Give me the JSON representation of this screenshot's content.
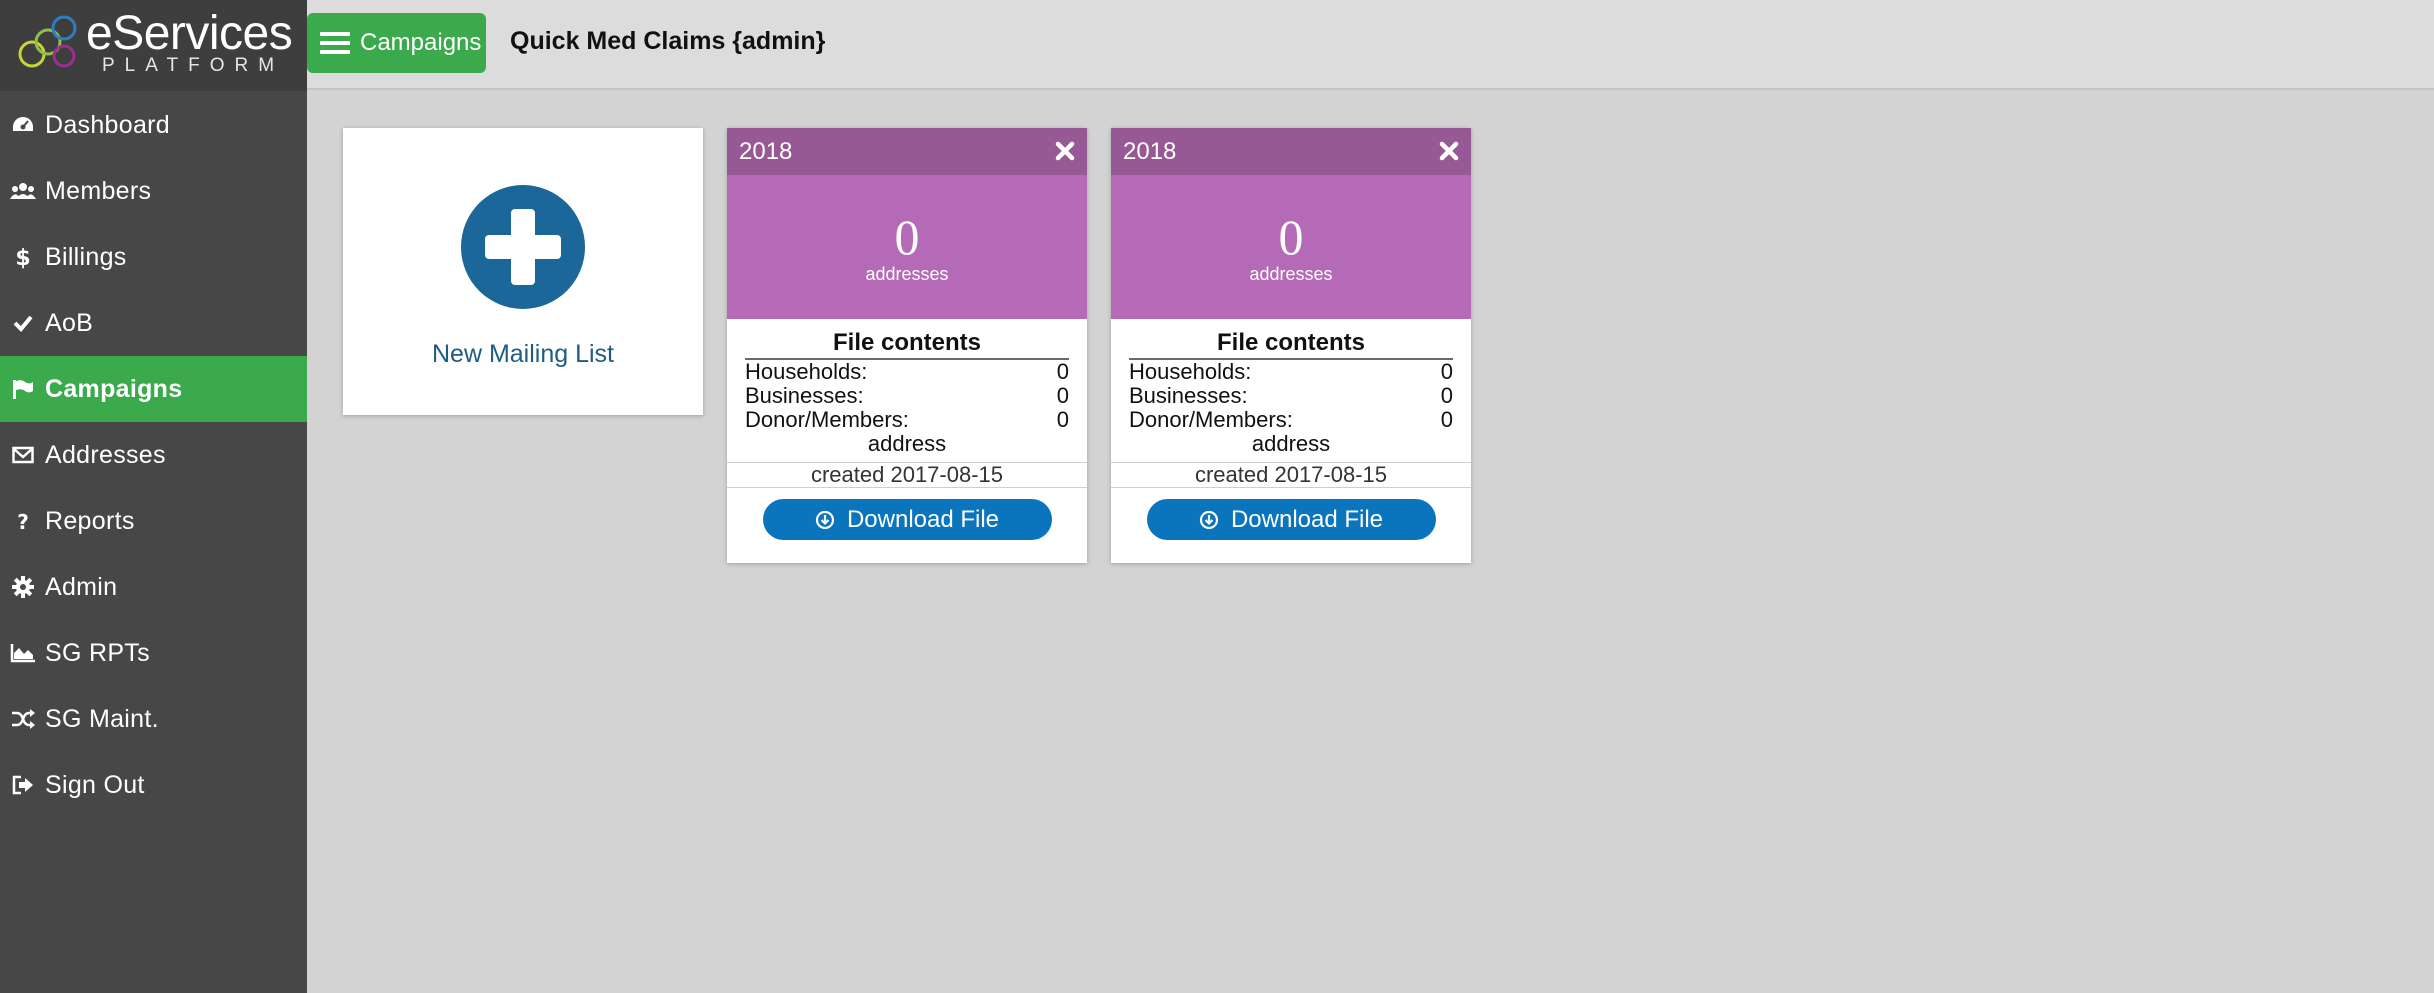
{
  "app": {
    "brand": "eServices",
    "brand_sub": "PLATFORM"
  },
  "sidebar": {
    "items": [
      {
        "label": "Dashboard",
        "icon": "dashboard-icon"
      },
      {
        "label": "Members",
        "icon": "users-icon"
      },
      {
        "label": "Billings",
        "icon": "dollar-icon"
      },
      {
        "label": "AoB",
        "icon": "check-icon"
      },
      {
        "label": "Campaigns",
        "icon": "flag-icon",
        "active": true
      },
      {
        "label": "Addresses",
        "icon": "envelope-icon"
      },
      {
        "label": "Reports",
        "icon": "question-icon"
      },
      {
        "label": "Admin",
        "icon": "gear-icon"
      },
      {
        "label": "SG RPTs",
        "icon": "area-chart-icon"
      },
      {
        "label": "SG Maint.",
        "icon": "random-icon"
      },
      {
        "label": "Sign Out",
        "icon": "sign-out-icon"
      }
    ]
  },
  "topbar": {
    "menu_label": "Campaigns",
    "title": "Quick Med Claims {admin}"
  },
  "new_card": {
    "label": "New Mailing List"
  },
  "lists": [
    {
      "year": "2018",
      "count": "0",
      "count_unit": "addresses",
      "contents_title": "File contents",
      "households_label": "Households:",
      "households": "0",
      "businesses_label": "Businesses:",
      "businesses": "0",
      "donors_label": "Donor/Members:",
      "donors": "0",
      "donors_cont": "address",
      "created": "created 2017-08-15",
      "download_label": "Download File"
    },
    {
      "year": "2018",
      "count": "0",
      "count_unit": "addresses",
      "contents_title": "File contents",
      "households_label": "Households:",
      "households": "0",
      "businesses_label": "Businesses:",
      "businesses": "0",
      "donors_label": "Donor/Members:",
      "donors": "0",
      "donors_cont": "address",
      "created": "created 2017-08-15",
      "download_label": "Download File"
    }
  ],
  "colors": {
    "sidebar_bg": "#474747",
    "active_green": "#3aaa4c",
    "card_header": "#975995",
    "card_stat": "#b56ab7",
    "download_blue": "#0a74bc",
    "plus_blue": "#1b6799"
  }
}
